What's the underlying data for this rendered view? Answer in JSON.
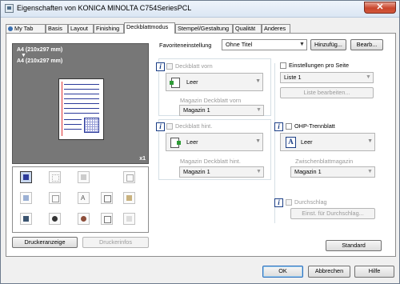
{
  "window": {
    "title": "Eigenschaften von KONICA MINOLTA C754SeriesPCL",
    "close_label": "✕"
  },
  "tabs": [
    {
      "label": "My Tab"
    },
    {
      "label": "Basis"
    },
    {
      "label": "Layout"
    },
    {
      "label": "Finishing"
    },
    {
      "label": "Deckblattmodus"
    },
    {
      "label": "Stempel/Gestaltung"
    },
    {
      "label": "Qualität"
    },
    {
      "label": "Anderes"
    }
  ],
  "favorites": {
    "label": "Favoriteneinstellung",
    "value": "Ohne Titel",
    "add_button": "Hinzufüg...",
    "edit_button": "Bearb..."
  },
  "preview": {
    "paper_line1": "A4 (210x297 mm)",
    "arrow": "▼",
    "paper_line2": "A4 (210x297 mm)",
    "copies": "x1"
  },
  "left_buttons": {
    "printer_view": "Druckeranzeige",
    "printer_info": "Druckerinfos"
  },
  "front_cover": {
    "checkbox_label": "Deckblatt vorn",
    "value": "Leer",
    "tray_label": "Magazin Deckblatt vorn",
    "tray_value": "Magazin 1"
  },
  "back_cover": {
    "checkbox_label": "Deckblatt hint.",
    "value": "Leer",
    "tray_label": "Magazin Deckblatt hint.",
    "tray_value": "Magazin 1"
  },
  "per_page": {
    "checkbox_label": "Einstellungen pro Seite",
    "list_value": "Liste 1",
    "edit_button": "Liste bearbeiten..."
  },
  "ohp": {
    "checkbox_label": "OHP-Trennblatt",
    "value": "Leer",
    "tray_label": "Zwischenblattmagazin",
    "tray_value": "Magazin 1"
  },
  "carbon": {
    "checkbox_label": "Durchschlag",
    "settings_button": "Einst. für Durchschlag..."
  },
  "standard_button": "Standard",
  "dialog_buttons": {
    "ok": "OK",
    "cancel": "Abbrechen",
    "help": "Hilfe"
  },
  "info_icon_glyph": "i",
  "dropdown_arrow_glyph": "▼"
}
